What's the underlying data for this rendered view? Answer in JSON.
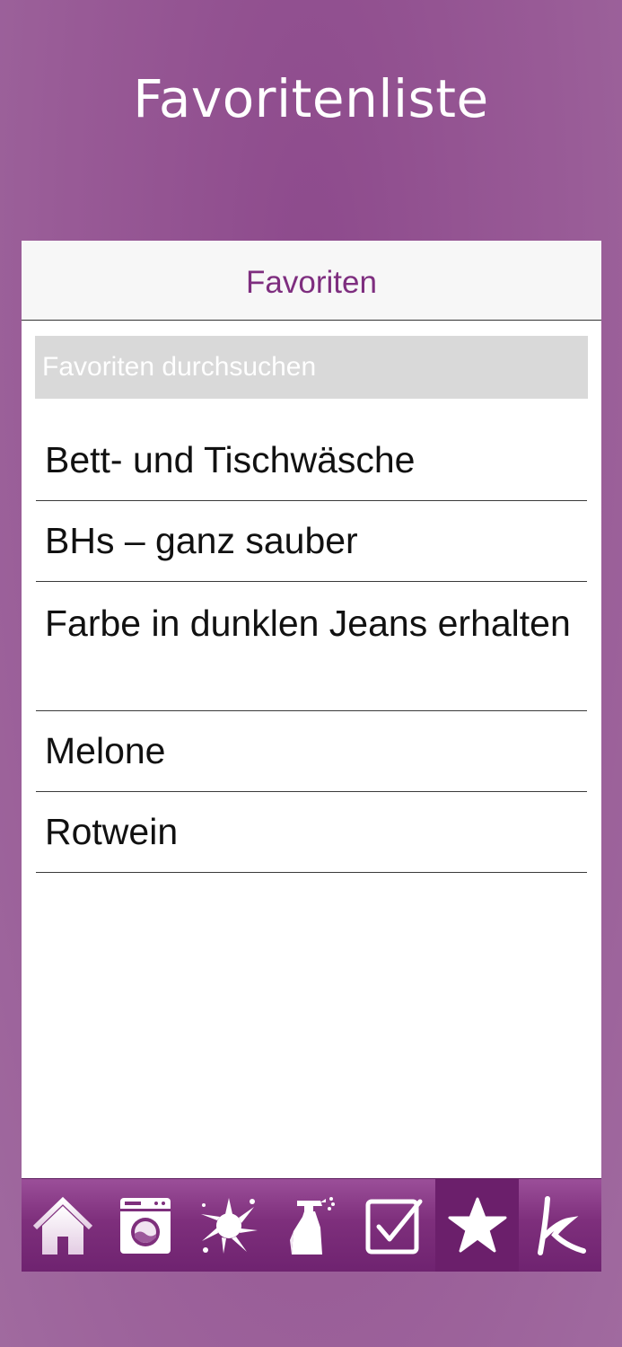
{
  "header": {
    "title": "Favoritenliste"
  },
  "navbar": {
    "title": "Favoriten"
  },
  "search": {
    "placeholder": "Favoriten durchsuchen"
  },
  "favorites": [
    "Bett- und Tischwäsche",
    "BHs – ganz sauber",
    "Farbe in dunklen Jeans erhalten",
    "Melone",
    "Rotwein"
  ],
  "tabbar": {
    "tabs": [
      {
        "icon": "home-icon"
      },
      {
        "icon": "washing-machine-icon"
      },
      {
        "icon": "stain-splash-icon"
      },
      {
        "icon": "spray-bottle-icon"
      },
      {
        "icon": "checkbox-icon"
      },
      {
        "icon": "star-icon",
        "active": true
      },
      {
        "icon": "k-logo-icon"
      }
    ]
  },
  "colors": {
    "background": "#985a96",
    "accent": "#7e2e7f",
    "tabbar": "#7e2f7c",
    "tab_active": "#6b1f6b",
    "search_field": "#d9d9d9"
  }
}
